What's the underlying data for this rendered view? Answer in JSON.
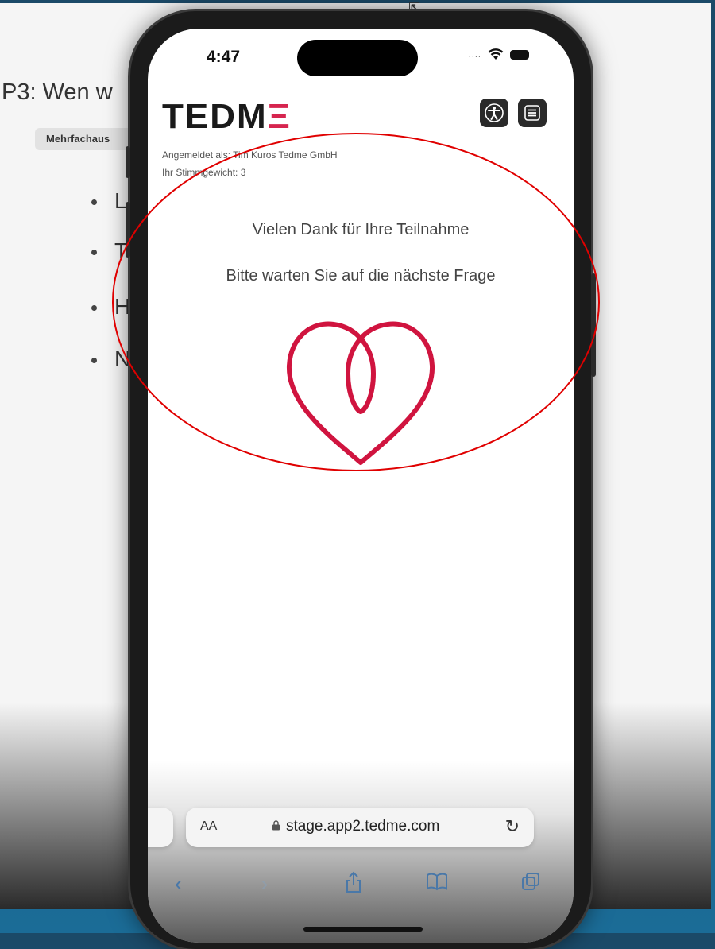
{
  "slide": {
    "title": "P3: Wen w",
    "tag": "Mehrfachaus",
    "bullets": [
      "L",
      "T",
      "H",
      "N"
    ]
  },
  "status_bar": {
    "time": "4:47",
    "signal": "....",
    "icons": [
      "wifi-icon",
      "battery-icon"
    ]
  },
  "app": {
    "logo_dark": "TEDM",
    "logo_accent": "Ξ",
    "accent_color": "#d6254f",
    "logged_in_line": "Angemeldet als: Tim Kuros Tedme GmbH",
    "vote_weight_line": "Ihr Stimmgewicht: 3",
    "thanks_message": "Vielen Dank für Ihre Teilnahme",
    "wait_message": "Bitte warten Sie auf die nächste Frage",
    "header_buttons": [
      "accessibility-icon",
      "menu-icon"
    ]
  },
  "browser": {
    "aa_label": "AA",
    "url": "stage.app2.tedme.com",
    "toolbar": [
      "back-icon",
      "forward-icon",
      "share-icon",
      "bookmarks-icon",
      "tabs-icon"
    ]
  },
  "annotation_color": "#e00000"
}
